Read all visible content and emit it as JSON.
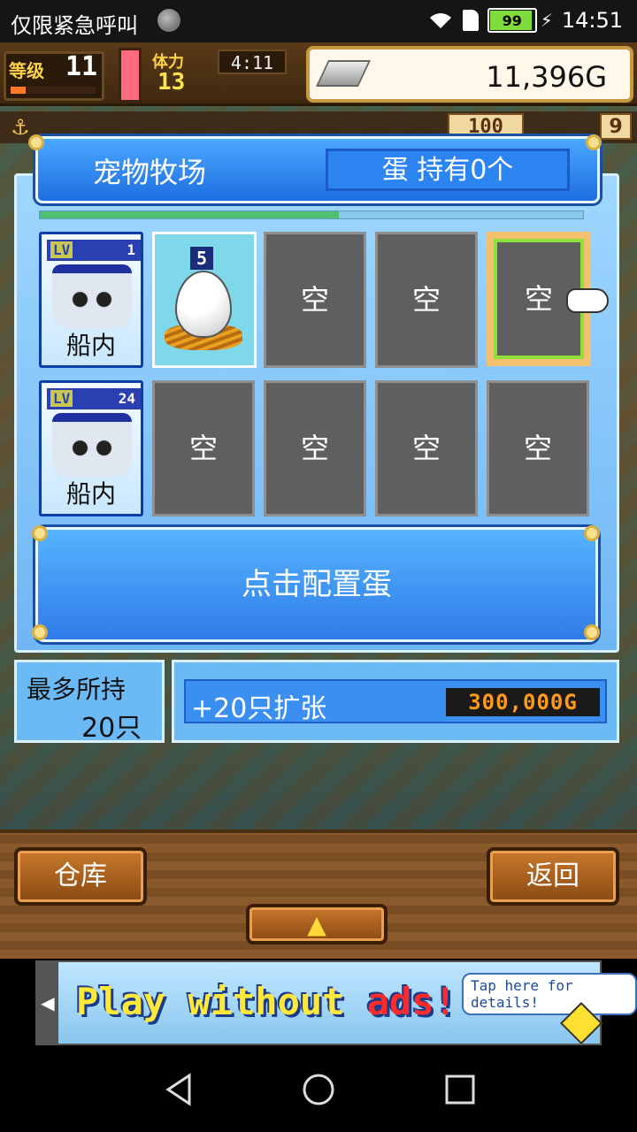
{
  "status_bar": {
    "carrier": "仅限紧急呼叫",
    "battery": "99",
    "time": "14:51"
  },
  "hud": {
    "level_label": "等级",
    "level": "11",
    "stamina_label": "体力",
    "stamina": "13",
    "timer": "4:11",
    "gold": "11,396G",
    "counter": "100",
    "small_count": "9"
  },
  "panel": {
    "title": "宠物牧场",
    "egg_count": "蛋 持有0个",
    "progress": 0.55
  },
  "pets": [
    {
      "lv_tag": "LV",
      "lv": "1",
      "location": "船内"
    },
    {
      "lv_tag": "LV",
      "lv": "24",
      "location": "船内"
    }
  ],
  "slots": {
    "egg_badge": "5",
    "empty_label": "空"
  },
  "place_egg_button": "点击配置蛋",
  "capacity": {
    "label": "最多所持",
    "value": "20只"
  },
  "expand": {
    "label": "+20只扩张",
    "price": "300,000G"
  },
  "bottom_bar": {
    "warehouse": "仓库",
    "back": "返回",
    "up_arrow": "▲"
  },
  "ad": {
    "text_part1": "Play without ",
    "text_part2": "ads!",
    "tap": "Tap here for details!"
  }
}
